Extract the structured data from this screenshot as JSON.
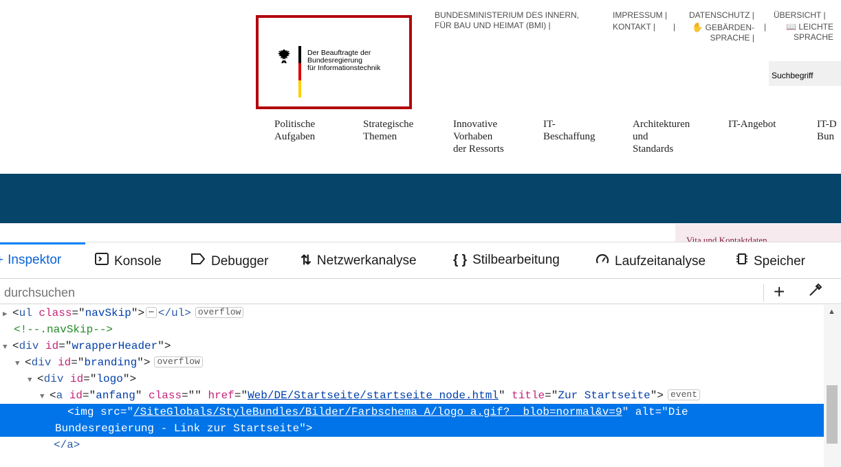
{
  "site": {
    "logo_text": [
      "Der Beauftragte der",
      "Bundesregierung",
      "für Informationstechnik"
    ],
    "eagle_icon": "federal-eagle-icon",
    "flag_colors": [
      "#000000",
      "#dd0000",
      "#ffce00"
    ],
    "logo_border_color": "#b3050c",
    "meta_links": {
      "bmi_line1": "BUNDESMINISTERIUM DES INNERN,",
      "bmi_line2": "FÜR BAU UND HEIMAT (BMI) |",
      "impressum": "IMPRESSUM |",
      "kontakt": "KONTAKT |",
      "datenschutz": "DATENSCHUTZ |",
      "gebaerden1": "GEBÄRDEN-",
      "gebaerden2": "SPRACHE |",
      "uebersicht": "ÜBERSICHT |",
      "leichte1": "LEICHTE",
      "leichte2": "SPRACHE",
      "sep": "|"
    },
    "search_placeholder": "Suchbegriff",
    "nav": [
      {
        "line1": "Politische",
        "line2": "Aufgaben",
        "line3": ""
      },
      {
        "line1": "Strategische",
        "line2": "Themen",
        "line3": ""
      },
      {
        "line1": "Innovative",
        "line2": "Vorhaben",
        "line3": "der Ressorts"
      },
      {
        "line1": "IT-",
        "line2": "Beschaffung",
        "line3": ""
      },
      {
        "line1": "Architekturen",
        "line2": "und",
        "line3": "Standards"
      },
      {
        "line1": "IT-Angebot",
        "line2": "",
        "line3": ""
      },
      {
        "line1": "IT-D",
        "line2": "Bun",
        "line3": ""
      }
    ],
    "banner_color": "#064469",
    "vita_label": "Vita und Kontaktdaten"
  },
  "devtools": {
    "tabs": [
      {
        "label": "Inspektor",
        "icon": "inspector-icon"
      },
      {
        "label": "Konsole",
        "icon": "console-icon"
      },
      {
        "label": "Debugger",
        "icon": "debugger-icon"
      },
      {
        "label": "Netzwerkanalyse",
        "icon": "network-icon"
      },
      {
        "label": "Stilbearbeitung",
        "icon": "style-editor-icon"
      },
      {
        "label": "Laufzeitanalyse",
        "icon": "performance-icon"
      },
      {
        "label": "Speicher",
        "icon": "memory-icon"
      }
    ],
    "search_placeholder": "durchsuchen",
    "tree": {
      "navskip": {
        "tag": "ul",
        "attr": "class",
        "value": "navSkip",
        "ellipsis": "⋯",
        "close": "</ul>",
        "badge": "overflow"
      },
      "comment": "<!--.navSkip-->",
      "wrapper": {
        "tag": "div",
        "attr": "id",
        "value": "wrapperHeader"
      },
      "branding": {
        "tag": "div",
        "attr": "id",
        "value": "branding",
        "badge": "overflow"
      },
      "logo": {
        "tag": "div",
        "attr": "id",
        "value": "logo"
      },
      "anchor": {
        "tag": "a",
        "id_attr": "id",
        "id_value": "anfang",
        "class_attr": "class",
        "class_value": "",
        "href_attr": "href",
        "href_value": "Web/DE/Startseite/startseite_node.html",
        "title_attr": "title",
        "title_value": "Zur Startseite",
        "badge": "event"
      },
      "img": {
        "tag": "img",
        "src_attr": "src",
        "src_value": "/SiteGlobals/StyleBundles/Bilder/Farbschema_A/logo_a.gif?__blob=normal&v=9",
        "alt_attr": "alt",
        "alt_value_line1": "Die",
        "alt_value_line2": "Bundesregierung - Link zur Startseite"
      },
      "close_a": "</a>"
    }
  }
}
